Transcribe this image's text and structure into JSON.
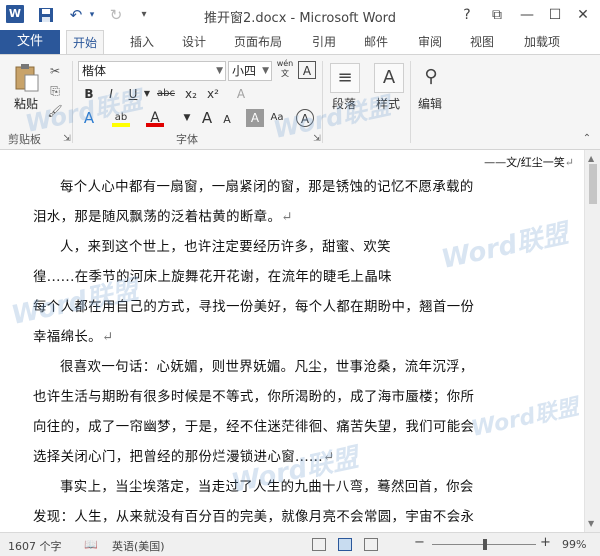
{
  "window": {
    "title": "推开窗2.docx - Microsoft Word",
    "app_logo": "W",
    "buttons": [
      "?",
      "⧉",
      "—",
      "☐",
      "✕"
    ]
  },
  "qat": {
    "save_icon": "💾",
    "undo_icon": "↶",
    "redo_icon": "↻",
    "customize_icon": "▾"
  },
  "tabs": {
    "file": "文件",
    "items": [
      "开始",
      "插入",
      "设计",
      "页面布局",
      "引用",
      "邮件",
      "审阅",
      "视图",
      "加载项"
    ],
    "active": "开始"
  },
  "ribbon": {
    "clipboard": {
      "paste": "粘贴",
      "group": "剪贴板"
    },
    "font": {
      "name": "楷体",
      "size": "小四",
      "group": "字体",
      "wen_label": "wén",
      "buttons": [
        "B",
        "I",
        "U",
        "abc",
        "x₂",
        "x²",
        "A",
        "ab",
        "A",
        "A",
        "A",
        "A",
        "Aa",
        "A"
      ]
    },
    "paragraph": {
      "label": "段落"
    },
    "styles": {
      "label": "样式"
    },
    "editing": {
      "label": "编辑"
    }
  },
  "document": {
    "author_line": "——文/红尘一笑",
    "lines": [
      "每个人心中都有一扇窗，一扇紧闭的窗，那是锈蚀的记忆不愿承载的",
      "泪水，那是随风飘荡的泛着枯黄的断章。",
      "人，来到这个世上，也许注定要经历许多，甜蜜、欢笑",
      "徨......在季节的河床上旋舞花开花谢，在流年的睫毛上晶味",
      "每个人都在用自己的方式，寻找一份美好，每个人都在期盼中，翘首一份",
      "幸福绵长。",
      "很喜欢一句话：心妩媚，则世界妩媚。凡尘，世事沧桑，流年沉浮，",
      "也许生活与期盼有很多时候是不等式，你所渴盼的，成了海市蜃楼；你所",
      "向往的，成了一帘幽梦，于是，经不住迷茫徘徊、痛苦失望，我们可能会",
      "选择关闭心门，把曾经的那份烂漫锁进心窗......",
      "事实上，当尘埃落定，当走过了人生的九曲十八弯，蓦然回首，你会",
      "发现：人生，从来就没有百分百的完美，就像月亮不会常圆，宇宙不会永"
    ],
    "para_mark": "↵",
    "watermark": "Word联盟",
    "watermark_url": "www.wordlm.com"
  },
  "status": {
    "word_count": "1607 个字",
    "language": "英语(美国)",
    "zoom": "99%",
    "zoom_minus": "−",
    "zoom_plus": "+"
  },
  "colors": {
    "accent": "#2b579a",
    "highlight": "#ffff00",
    "font_color": "#e00000"
  }
}
